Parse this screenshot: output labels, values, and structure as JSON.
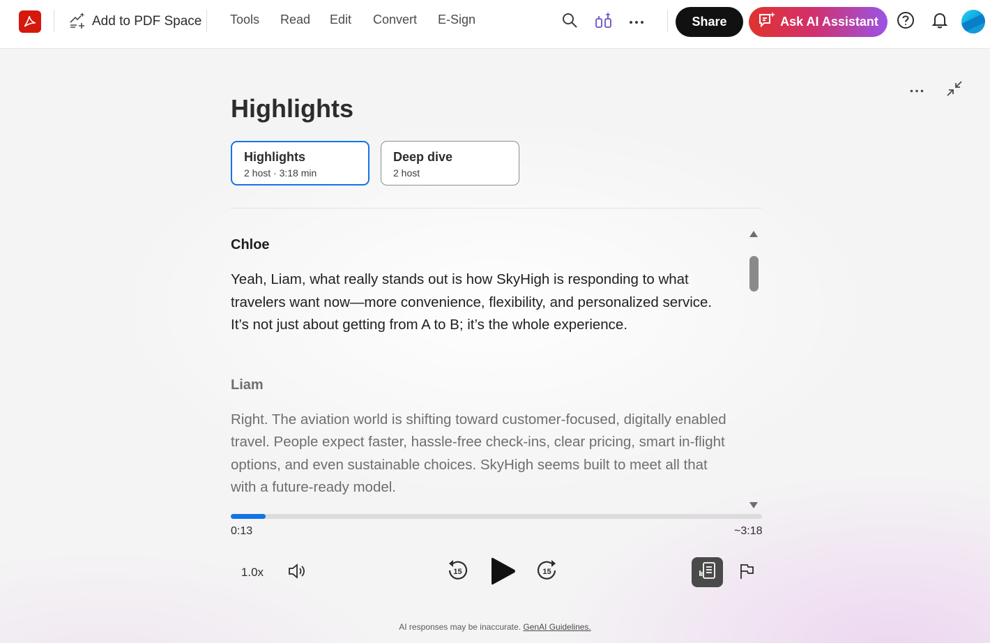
{
  "header": {
    "add_space_label": "Add to PDF Space",
    "nav": [
      "Tools",
      "Read",
      "Edit",
      "Convert",
      "E-Sign"
    ],
    "share_label": "Share",
    "ai_label": "Ask AI Assistant",
    "icons": [
      "acrobat-logo-icon",
      "add-to-space-icon",
      "search-icon",
      "ai-sparkle-icon",
      "more-icon",
      "help-icon",
      "bell-icon"
    ],
    "brand_color": "#d4180c",
    "ai_gradient": [
      "#e0332d",
      "#9a54e6"
    ]
  },
  "panel": {
    "title": "Highlights",
    "options": [
      {
        "title": "Highlights",
        "sub": "2 host · 3:18 min",
        "selected": true
      },
      {
        "title": "Deep dive",
        "sub": "2 host",
        "selected": false
      }
    ]
  },
  "transcript": [
    {
      "speaker": "Chloe",
      "text": "Yeah, Liam, what really stands out is how SkyHigh is responding to what travelers want now—more convenience, flexibility, and personalized service. It’s not just about getting from A to B; it’s the whole experience.",
      "current": true
    },
    {
      "speaker": "Liam",
      "text": "Right. The aviation world is shifting toward customer-focused, digitally enabled travel. People expect faster, hassle-free check-ins, clear pricing, smart in-flight options, and even sustainable choices. SkyHigh seems built to meet all that with a future-ready model.",
      "current": false
    }
  ],
  "player": {
    "elapsed": "0:13",
    "total": "~3:18",
    "progress_fraction": 0.066,
    "speed": "1.0x",
    "skip_back_seconds": "15",
    "skip_forward_seconds": "15",
    "accent_color": "#1473e6"
  },
  "footer": {
    "disclaimer": "AI responses may be inaccurate.",
    "link": "GenAI Guidelines."
  }
}
